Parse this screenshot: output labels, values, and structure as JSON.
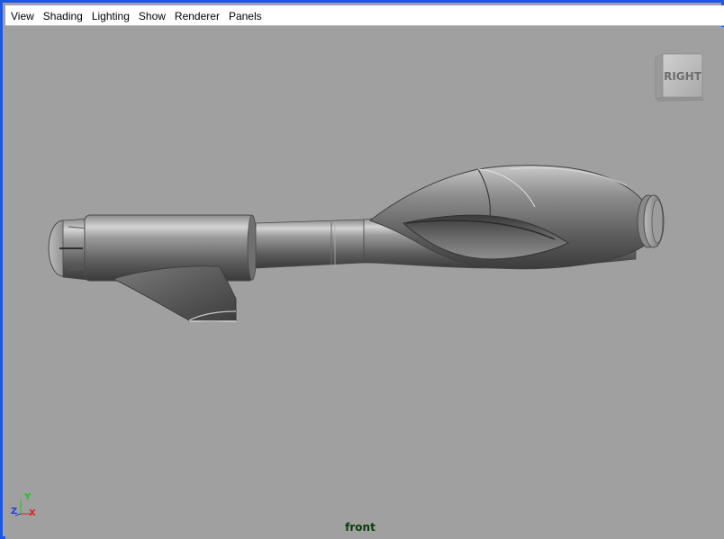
{
  "menubar": {
    "items": [
      "View",
      "Shading",
      "Lighting",
      "Show",
      "Renderer",
      "Panels"
    ]
  },
  "viewcube": {
    "face_label": "RIGHT"
  },
  "axis_gizmo": {
    "y_label": "Y",
    "z_label": "Z",
    "x_label": "X",
    "y_color": "#22c322",
    "z_color": "#2b3bd8",
    "x_color": "#d42a2a"
  },
  "viewport": {
    "camera_name": "front",
    "background_color": "#a0a0a0"
  }
}
